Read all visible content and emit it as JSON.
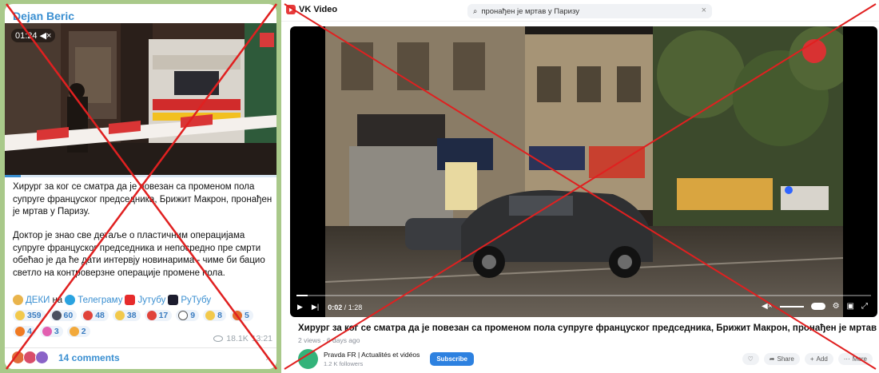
{
  "telegram": {
    "author": "Dejan Beric",
    "video_time": "01:24",
    "progress_fraction": 0.06,
    "paragraph1": "Хирург за ког се сматра да је  повезан са променом пола супруге француског председника, Брижит Макрон, пронађен је мртав у Паризу.",
    "paragraph2": "Доктор је знао све детаље о пластичним операцијама супруге француског председника и непосредно пре смрти обећао је да ће дати интервју новинарима - чиме би бацио светло на контроверзне операције промене пола.",
    "links": {
      "prefix": "ДЕКИ",
      "on": "на",
      "telegram": "Телеграму",
      "youtube": "Јутубу",
      "rutube": "РуТубу"
    },
    "reactions_row1": [
      {
        "emoji": "thinking",
        "count": "359",
        "color": "#f2c94c"
      },
      {
        "emoji": "dark-circle",
        "count": "60",
        "color": "#4a5060"
      },
      {
        "emoji": "hundred",
        "count": "48",
        "color": "#e0433b"
      },
      {
        "emoji": "grin",
        "count": "38",
        "color": "#f2c94c"
      },
      {
        "emoji": "heart",
        "count": "17",
        "color": "#e0433b"
      },
      {
        "emoji": "eyes",
        "count": "9",
        "color": "#ffffff"
      },
      {
        "emoji": "thumbs-down",
        "count": "8",
        "color": "#f2c94c"
      },
      {
        "emoji": "angry",
        "count": "5",
        "color": "#e36b2c"
      }
    ],
    "reactions_row2": [
      {
        "emoji": "fire",
        "count": "4",
        "color": "#f07a22"
      },
      {
        "emoji": "clown",
        "count": "3",
        "color": "#e25fb0"
      },
      {
        "emoji": "party",
        "count": "2",
        "color": "#f2a93b"
      }
    ],
    "views": "18.1K",
    "time": "13:21",
    "comments_label": "14 comments"
  },
  "vk": {
    "brand": "VK Video",
    "search_query": "пронађен је мртав у Паризу",
    "player": {
      "current_time": "0:02",
      "total_time": "1:28",
      "progress_fraction": 0.02
    },
    "video_title": "Хирург за ког се сматра да је повезан са променом пола супруге француског председника, Брижит Макрон, пронађен је мртав у Париз",
    "views": "2 views",
    "posted": "6 days ago",
    "channel_name": "Pravda FR | Actualités et vidéos",
    "followers": "1.2 K followers",
    "subscribe_label": "Subscribe",
    "share_label": "Share",
    "add_label": "Add",
    "more_label": "More"
  },
  "colors": {
    "telegram_accent": "#3a8fd1",
    "vk_accent": "#2d81e0",
    "cross": "#e02020",
    "background_green": "#a9c98a"
  }
}
